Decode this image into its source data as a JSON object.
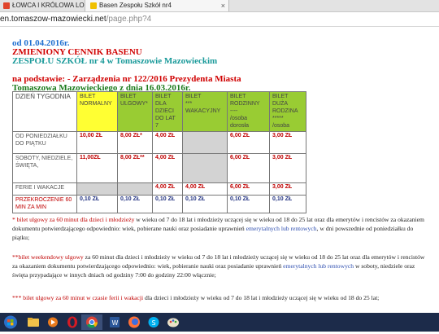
{
  "browser": {
    "tabs": [
      {
        "label": "ŁOWCA I KRÓLOWA LODU",
        "favicon_color": "#e0442b"
      },
      {
        "label": "Basen Zespołu Szkół nr4",
        "favicon_color": "#f0c000"
      }
    ],
    "url_host": "en.tomaszow-mazowiecki.net",
    "url_path": "/page.php?4"
  },
  "page": {
    "date_line": "od 01.04.2016r.",
    "title1": "ZMIENIONY CENNIK BASENU",
    "title2": "ZESPOŁU SZKÓŁ nr 4 w Tomaszowie Mazowieckim",
    "basis1": "na podstawie:  - Zarządzenia  nr 122/2016 Prezydenta Miasta",
    "basis2": "Tomaszowa Mazowieckiego  z dnia 16.03.2016r."
  },
  "table": {
    "corner": "DZIEŃ TYGODNIA",
    "headers": [
      {
        "l1": "BILET",
        "l2": "NORMALNY",
        "l3": "",
        "l4": ""
      },
      {
        "l1": "BILET",
        "l2": "ULGOWY*",
        "l3": "",
        "l4": ""
      },
      {
        "l1": "BILET",
        "l2": "DLA",
        "l3": "DZIECI",
        "l4": "DO LAT 7"
      },
      {
        "l1": "BILET",
        "l2": "***",
        "l3": "WAKACYJNY",
        "l4": ""
      },
      {
        "l1": "BILET",
        "l2": "RODZINNY",
        "l3": "----",
        "l4": "/osoba dorosła"
      },
      {
        "l1": "BILET",
        "l2": "DUŻA",
        "l3": "RODZINA",
        "l4": "*****"
      }
    ],
    "header6_extra": "/osoba",
    "rows": [
      {
        "label": "OD PONIEDZIAŁKU DO PIĄTKU",
        "v1": "10,00 ZŁ",
        "v2": "8,00 ZŁ*",
        "v3": "4,00 ZŁ",
        "v4": "",
        "v5": "6,00 ZŁ",
        "v6": "3,00 ZŁ"
      },
      {
        "label": "SOBOTY, NIEDZIELE, ŚWIĘTA,",
        "v1": "11,00ZŁ",
        "v2": "8,00 ZŁ**",
        "v3": "4,00 ZŁ",
        "v4": "",
        "v5": "6,00 ZŁ",
        "v6": "3,00 ZŁ"
      },
      {
        "label": "FERIE I WAKACJE",
        "v1": "",
        "v2": "",
        "v3": "4,00 ZŁ",
        "v4": "4,00 ZŁ",
        "v5": "6,00 ZŁ",
        "v6": "3,00 ZŁ"
      },
      {
        "label": "PRZEKROCZENIE 60 MIN ZA MIN",
        "v1": "0,10 ZŁ",
        "v2": "0,10 ZŁ",
        "v3": "0,10 ZŁ",
        "v4": "0,10 ZŁ",
        "v5": "0,10 ZŁ",
        "v6": "0,10 ZŁ"
      }
    ]
  },
  "notes": {
    "n1_star": "* ",
    "n1_red": "bilet ulgowy za 60 minut dla dzieci i młodzieży",
    "n1_rest": " w wieku od 7 do 18 lat i młodzieży uczącej się w wieku od 18 do 25 lat oraz dla emerytów i rencistów za okazaniem dokumentu potwierdzającego odpowiednio: wiek, pobierane nauki oraz posiadanie uprawnień ",
    "n1_blue": "emerytalnych lub rentowych",
    "n1_end": ", w dni powszednie od poniedziałku do piątku;",
    "n2_star": "**",
    "n2_red": "bilet weekendowy ulgowy",
    "n2_rest": " za 60 minut dla dzieci i młodzieży w wieku od 7 do 18 lat i młodzieży uczącej się w wieku od 18 do 25 lat oraz dla emerytów i rencistów za okazaniem dokumentu potwierdzającego odpowiednio: wiek, pobieranie nauki oraz posiadanie uprawnień ",
    "n2_blue": "emerytalnych lub rentowych",
    "n2_end": " w soboty, niedziele oraz święta przypadające w innych dniach od godziny 7:00 do godziny 22:00 włącznie;",
    "n3_star": "*** ",
    "n3_red": "bilet ulgowy za 60 minut w czasie ferii i wakacji",
    "n3_rest": " dla dzieci i młodzieży w wieku od 7 do 18 lat i młodzieży uczącej się w wieku od 18 do 25 lat;"
  },
  "colors": {
    "date_blue": "#1f6fd0",
    "title_red": "#d00000",
    "title_teal": "#1a9a9a",
    "basis_red": "#d00000",
    "basis_green": "#1a7a1a",
    "yellow_col": "#ffff33",
    "green_col": "#99cc33"
  },
  "taskbar": {
    "icons": [
      "windows-start-icon",
      "folder-icon",
      "media-icon",
      "opera-icon",
      "chrome-icon",
      "word-icon",
      "firefox-icon",
      "skype-icon",
      "paint-icon"
    ]
  }
}
